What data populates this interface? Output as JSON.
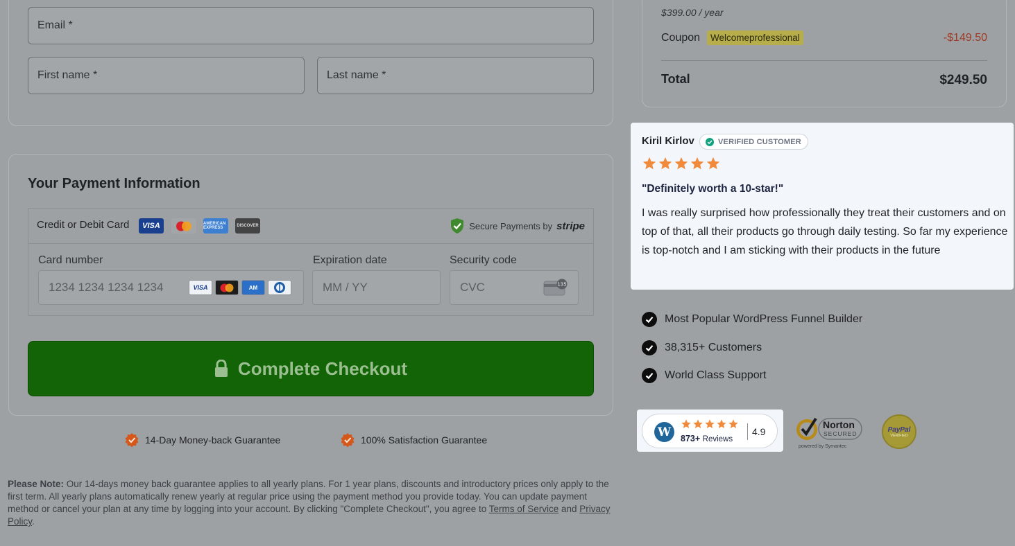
{
  "contact": {
    "email_placeholder": "Email *",
    "first_name_placeholder": "First name *",
    "last_name_placeholder": "Last name *"
  },
  "payment": {
    "title": "Your Payment Information",
    "method_label": "Credit or Debit Card",
    "brands": [
      "VISA",
      "mastercard",
      "AMERICAN EXPRESS",
      "DISCOVER"
    ],
    "secure_text": "Secure Payments by",
    "secure_brand": "stripe",
    "card_number_label": "Card number",
    "card_number_placeholder": "1234 1234 1234 1234",
    "expiration_label": "Expiration date",
    "expiration_placeholder": "MM / YY",
    "security_label": "Security code",
    "security_placeholder": "CVC",
    "cvc_hint": "135",
    "checkout_label": "Complete Checkout",
    "checkout_color": "#126406"
  },
  "guarantees": [
    {
      "label": "14-Day Money-back Guarantee"
    },
    {
      "label": "100% Satisfaction Guarantee"
    }
  ],
  "note": {
    "bold": "Please Note:",
    "text": " Our 14-days money back guarantee applies to all yearly plans. For 1 year plans, discounts and introductory prices only apply to the first term. All yearly plans automatically renew yearly at regular price using the payment method you provide today. You can update payment method or cancel your plan at any time by logging into your account. By clicking \"Complete Checkout\", you agree to ",
    "terms_link": "Terms of Service",
    "and": " and ",
    "privacy_link": "Privacy Policy",
    "end": "."
  },
  "summary": {
    "price": "$399.00",
    "period": " / year",
    "coupon_label": "Coupon",
    "coupon_code": "Welcomeprofessional",
    "coupon_amount": "-$149.50",
    "total_label": "Total",
    "total_amount": "$249.50"
  },
  "review": {
    "name": "Kiril Kirlov",
    "badge": "VERIFIED CUSTOMER",
    "rating": 5,
    "title": "\"Definitely worth a 10-star!\"",
    "body": "I was really surprised how professionally they treat their customers and on top of that, all their products go through daily testing. So far my experience is top-notch and I am sticking with their products in the future"
  },
  "features": [
    {
      "label": "Most Popular WordPress Funnel Builder"
    },
    {
      "label": "38,315+ Customers"
    },
    {
      "label": "World Class Support"
    }
  ],
  "trust": {
    "wp_reviews_count": "873+",
    "wp_reviews_word": "Reviews",
    "wp_rating": "4.9",
    "norton_name": "Norton",
    "norton_secured": "SECURED",
    "norton_powered": "powered by Symantec",
    "paypal_name": "PayPal",
    "paypal_verified": "VERIFIED"
  },
  "colors": {
    "star": "#f08a3c",
    "coupon_amount": "#9c3a22",
    "guarantee_badge": "#d4581c"
  }
}
